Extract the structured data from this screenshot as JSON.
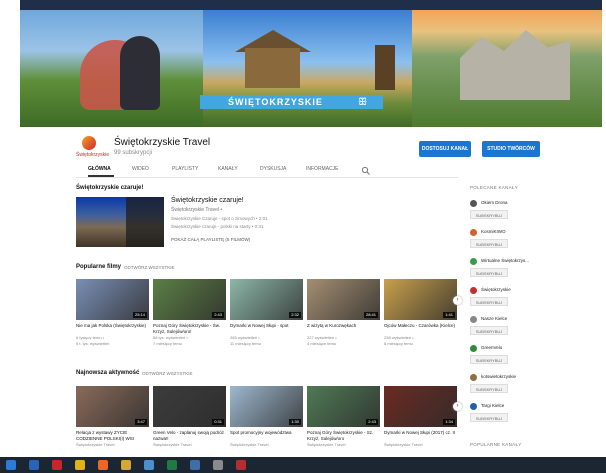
{
  "banner": {
    "ribbon_text": "ŚWIĘTOKRZYSKIE",
    "ribbon_mark": "ꕥ"
  },
  "channel": {
    "logo_text": "Świętokrzyskie",
    "title": "Świętokrzyskie Travel",
    "subscribers": "99 subskrypcji",
    "customize_label": "DOSTOSUJ KANAŁ",
    "studio_label": "STUDIO TWÓRCÓW"
  },
  "tabs": [
    "GŁÓWNA",
    "WIDEO",
    "PLAYLISTY",
    "KANAŁY",
    "DYSKUSJA",
    "INFORMACJE"
  ],
  "featured": {
    "heading": "Świętokrzyskie czaruje!",
    "title": "Świętokrzyskie czaruje!",
    "channel": "Świętokrzyskie Travel •",
    "lines": [
      "Świętokrzyskie Czaruje - spot o zimowych • 2:01",
      "Świętokrzyskie czaruje - polski na starty • 0:31"
    ],
    "all_label": "POKAŻ CAŁĄ PLAYLISTĘ (5 FILMÓW)"
  },
  "popular": {
    "heading": "Popularne filmy",
    "play_all": "ODTWÓRZ WSZYSTKIE",
    "videos": [
      {
        "title": "Nie ma jak Polska (Świętokrzyskie)",
        "meta1": "6 tysięcy temu •",
        "meta2": "5 t. tys. wyświetleń",
        "dur": "25:14",
        "color": "#7a8fb5"
      },
      {
        "title": "Poznaj Góry Świętokrzyskie - Św. Krzyż, Sulejów/oro!",
        "meta1": "58 tys. wyświetleń •",
        "meta2": "7 miesięcy temu",
        "dur": "2:43",
        "color": "#5c7f45"
      },
      {
        "title": "Dymarki w Nowej Słupi - spot",
        "meta1": "265 wyświetleń •",
        "meta2": "11 miesięcy temu",
        "dur": "2:32",
        "color": "#8db7a8"
      },
      {
        "title": "Z wizytą w Kurozwękach",
        "meta1": "227 wyświetleń •",
        "meta2": "4 miesiące temu",
        "dur": "28:41",
        "color": "#a48f72"
      },
      {
        "title": "Ojców Małeczu - Czarówka (Kielce)",
        "meta1": "238 wyświetleń •",
        "meta2": "8 miesięcy temu",
        "dur": "1:41",
        "color": "#c9a04b"
      }
    ]
  },
  "latest": {
    "heading": "Najnowsza aktywność",
    "play_all": "ODTWÓRZ WSZYSTKIE",
    "videos": [
      {
        "title": "Relacja z wystawy ZYCIE CODZIENNE POLSKI(I) WSI",
        "meta1": "Świętokrzyskie Travel",
        "dur": "3:47",
        "color": "#8a6a5a"
      },
      {
        "title": "Green Velo - zaplanuj swoją podróż nazwa!!",
        "meta1": "Świętokrzyskie Travel",
        "dur": "0:31",
        "color": "#3c3c3c"
      },
      {
        "title": "Spot promocyjny województwa",
        "meta1": "Świętokrzyskie Travel",
        "dur": "1:30",
        "color": "#9eb8cf"
      },
      {
        "title": "Poznaj Góry Świętokrzyskie - Sz. Krzyż, Sulejów/oro",
        "meta1": "Świętokrzyskie Travel",
        "dur": "2:43",
        "color": "#4f7a55"
      },
      {
        "title": "Dymarki w Nowej Słupi (2017) cz. II",
        "meta1": "Świętokrzyskie Travel",
        "dur": "1:34",
        "color": "#6b2a22"
      }
    ]
  },
  "sidebar": {
    "heading": "POLECANE KANAŁY",
    "sub_label": "SUBSKRYBUJ",
    "channels": [
      {
        "name": "Okiem Drona",
        "color": "#555555"
      },
      {
        "name": "KosmiKIWO",
        "color": "#d1642b"
      },
      {
        "name": "Wirtualne Świętokrzys...",
        "color": "#3b9a4a"
      },
      {
        "name": "Świętokrzyskie",
        "color": "#c03030"
      },
      {
        "name": "Nasze Kielce",
        "color": "#888888"
      },
      {
        "name": "GreenVelo",
        "color": "#2f8a3a"
      },
      {
        "name": "kotswietokrzyskie",
        "color": "#8f6f3f"
      },
      {
        "name": "Targi Kielce",
        "color": "#1f5fa8"
      }
    ],
    "footer_heading": "POPULARNE KANAŁY"
  },
  "taskbar": {
    "icons": [
      {
        "name": "start-icon",
        "color": "#2b7bd8"
      },
      {
        "name": "outlook-icon",
        "color": "#2a64b8"
      },
      {
        "name": "acrobat-icon",
        "color": "#c8262c"
      },
      {
        "name": "chrome-icon",
        "color": "#e0b020"
      },
      {
        "name": "firefox-icon",
        "color": "#e8682a"
      },
      {
        "name": "explorer-icon",
        "color": "#d4a73c"
      },
      {
        "name": "paint-icon",
        "color": "#4a8fd0"
      },
      {
        "name": "excel-icon",
        "color": "#1f7a44"
      },
      {
        "name": "mail-icon",
        "color": "#3f6ea8"
      },
      {
        "name": "media-icon",
        "color": "#8a8a8a"
      },
      {
        "name": "pdf-icon",
        "color": "#b03030"
      }
    ]
  }
}
